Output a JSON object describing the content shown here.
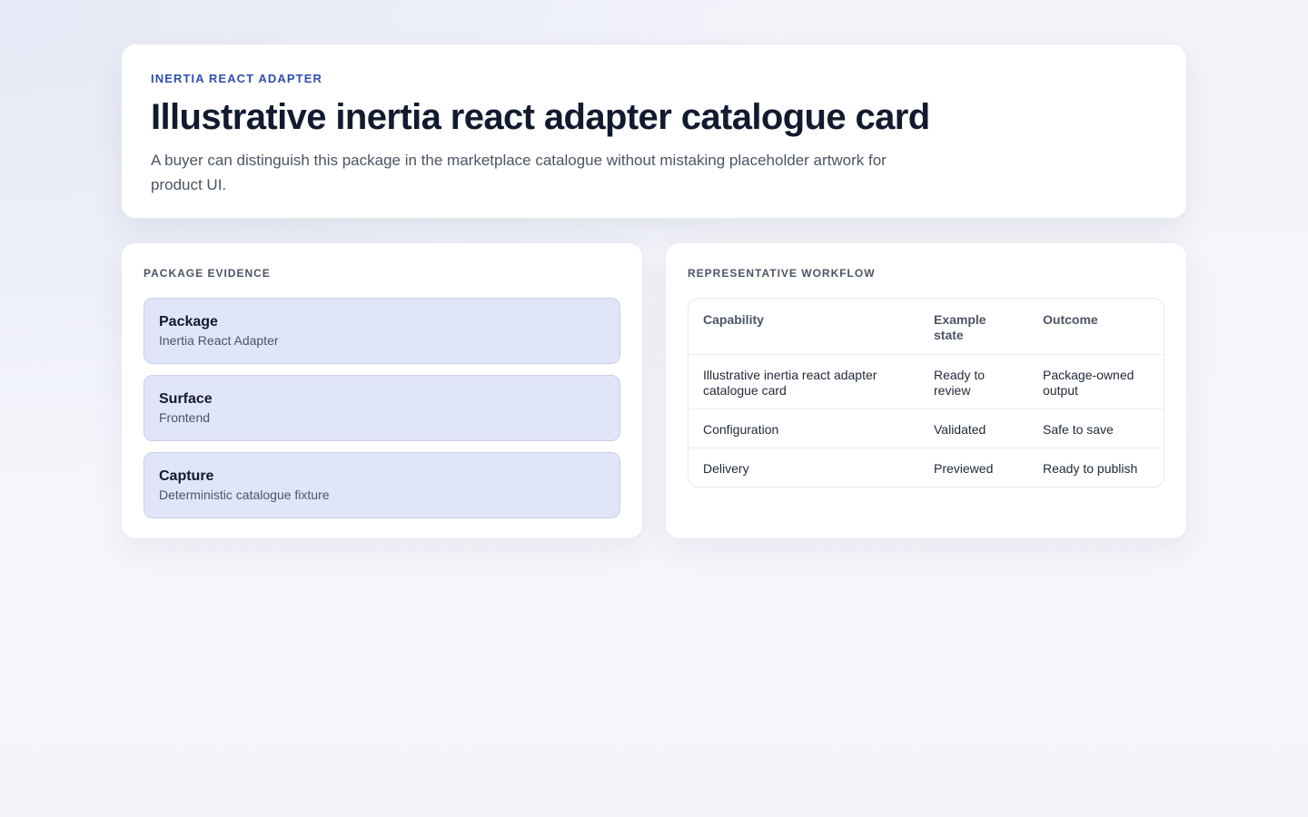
{
  "hero": {
    "eyebrow": "INERTIA REACT ADAPTER",
    "title": "Illustrative inertia react adapter catalogue card",
    "description": "A buyer can distinguish this package in the marketplace catalogue without mistaking placeholder artwork for product UI."
  },
  "evidence": {
    "label": "PACKAGE EVIDENCE",
    "items": [
      {
        "title": "Package",
        "value": "Inertia React Adapter"
      },
      {
        "title": "Surface",
        "value": "Frontend"
      },
      {
        "title": "Capture",
        "value": "Deterministic catalogue fixture"
      }
    ]
  },
  "workflow": {
    "label": "REPRESENTATIVE WORKFLOW",
    "columns": [
      "Capability",
      "Example state",
      "Outcome"
    ],
    "rows": [
      [
        "Illustrative inertia react adapter catalogue card",
        "Ready to review",
        "Package-owned output"
      ],
      [
        "Configuration",
        "Validated",
        "Safe to save"
      ],
      [
        "Delivery",
        "Previewed",
        "Ready to publish"
      ]
    ]
  }
}
